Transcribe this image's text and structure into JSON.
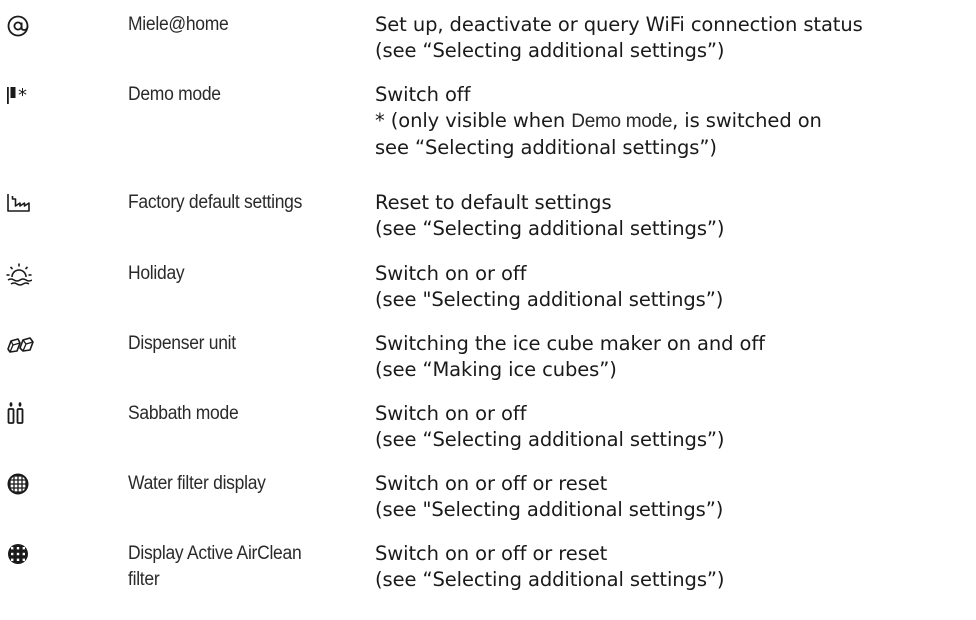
{
  "rows": [
    {
      "icon": "at-sign-icon",
      "name": "Miele@home",
      "desc_line1": "Set up, deactivate or query WiFi connection status",
      "desc_line2": "(see “Selecting additional settings”)"
    },
    {
      "icon": "demo-mode-icon",
      "name": "Demo mode",
      "desc_line1": "Switch off",
      "desc_line2_pre": "* (only visible when ",
      "desc_line2_name": "Demo mode",
      "desc_line2_post": ", is switched on",
      "desc_line3": "see “Selecting additional settings”)"
    },
    {
      "icon": "factory-icon",
      "name": "Factory default settings",
      "desc_line1": "Reset to default settings",
      "desc_line2": "(see “Selecting additional settings”)"
    },
    {
      "icon": "holiday-sun-icon",
      "name": "Holiday",
      "desc_line1": "Switch on or off",
      "desc_line2": "(see \"Selecting additional settings”)"
    },
    {
      "icon": "ice-cubes-icon",
      "name": "Dispenser unit",
      "desc_line1": "Switching the ice cube maker on and off",
      "desc_line2": "(see “Making ice cubes”)"
    },
    {
      "icon": "sabbath-candles-icon",
      "name": "Sabbath mode",
      "desc_line1": "Switch on or off",
      "desc_line2": "(see “Selecting additional settings”)"
    },
    {
      "icon": "water-filter-icon",
      "name": "Water filter display",
      "desc_line1": "Switch on or off or reset",
      "desc_line2": "(see \"Selecting additional settings”)"
    },
    {
      "icon": "airclean-filter-icon",
      "name_line1": "Display Active AirClean",
      "name_line2": "filter",
      "desc_line1": "Switch on or off or reset",
      "desc_line2": "(see “Selecting additional settings”)"
    }
  ]
}
